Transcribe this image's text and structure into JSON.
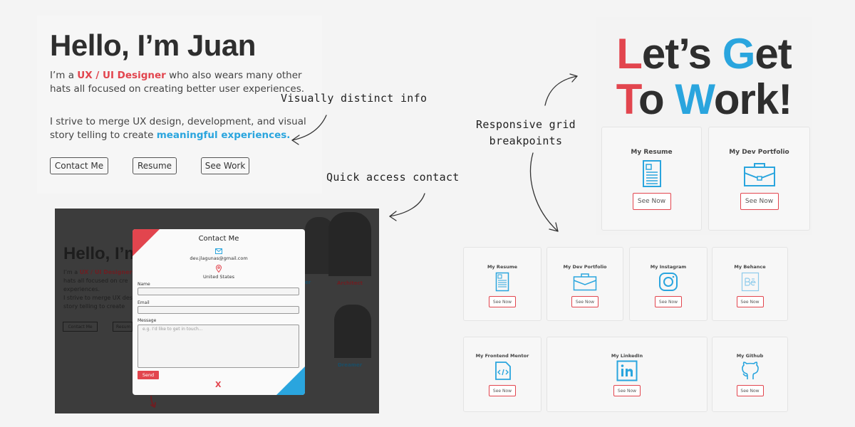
{
  "hero": {
    "greeting": "Hello, I’m Juan",
    "intro_prefix": "I’m a ",
    "intro_role": "UX / UI Designer",
    "intro_suffix": " who also wears many other hats all focused on creating better user experiences.",
    "strive_prefix": "I strive to merge UX design, development, and visual story telling to create ",
    "strive_highlight": "meaningful experiences.",
    "buttons": [
      "Contact Me",
      "Resume",
      "See Work"
    ]
  },
  "annotations": {
    "visually_distinct": "Visually distinct info",
    "quick_access": "Quick access contact",
    "responsive_line1": "Responsive grid",
    "responsive_line2": "breakpoints"
  },
  "work_panel": {
    "line1": {
      "l1": "L",
      "l1_rest": "et’s ",
      "l2": "G",
      "l2_rest": "et"
    },
    "line2": {
      "l1": "T",
      "l1_rest": "o ",
      "l2": "W",
      "l2_rest": "ork!"
    },
    "cards": [
      {
        "title": "My Resume",
        "icon": "resume-icon",
        "button": "See Now"
      },
      {
        "title": "My Dev Portfolio",
        "icon": "briefcase-icon",
        "button": "See Now"
      }
    ]
  },
  "modal_shot": {
    "bg_greeting": "Hello, I’m",
    "bg_intro_prefix": "I’m a ",
    "bg_intro_role": "UX / UI Designer",
    "bg_intro_lines": [
      "hats all focused on cre",
      "experiences.",
      "I strive to merge UX desi",
      "story telling to create"
    ],
    "bg_buttons": [
      "Contact Me",
      "Resum"
    ],
    "bg_labels": [
      "er",
      "Architect",
      "Dreamer"
    ],
    "modal": {
      "title": "Contact Me",
      "email": "dev.jlagunas@gmail.com",
      "location": "United States",
      "name_label": "Name",
      "email_label": "Email",
      "message_label": "Message",
      "message_placeholder": "e.g. I’d like to get in touch...",
      "send": "Send",
      "close": "X"
    }
  },
  "grid": {
    "row1": [
      {
        "title": "My Resume",
        "icon": "resume-icon",
        "button": "See Now"
      },
      {
        "title": "My Dev Portfolio",
        "icon": "briefcase-icon",
        "button": "See Now"
      },
      {
        "title": "My Instagram",
        "icon": "instagram-icon",
        "button": "See Now"
      },
      {
        "title": "My Behance",
        "icon": "behance-icon",
        "button": "See Now"
      }
    ],
    "row2": [
      {
        "title": "My Frontend Mentor",
        "icon": "code-file-icon",
        "button": "See Now"
      },
      {
        "title": "My LinkedIn",
        "icon": "linkedin-icon",
        "button": "See Now"
      },
      {
        "title": "My Github",
        "icon": "github-icon",
        "button": "See Now"
      }
    ]
  },
  "colors": {
    "accent_red": "#e2454e",
    "accent_blue": "#2aa5de",
    "text_dark": "#2e2e2e"
  }
}
